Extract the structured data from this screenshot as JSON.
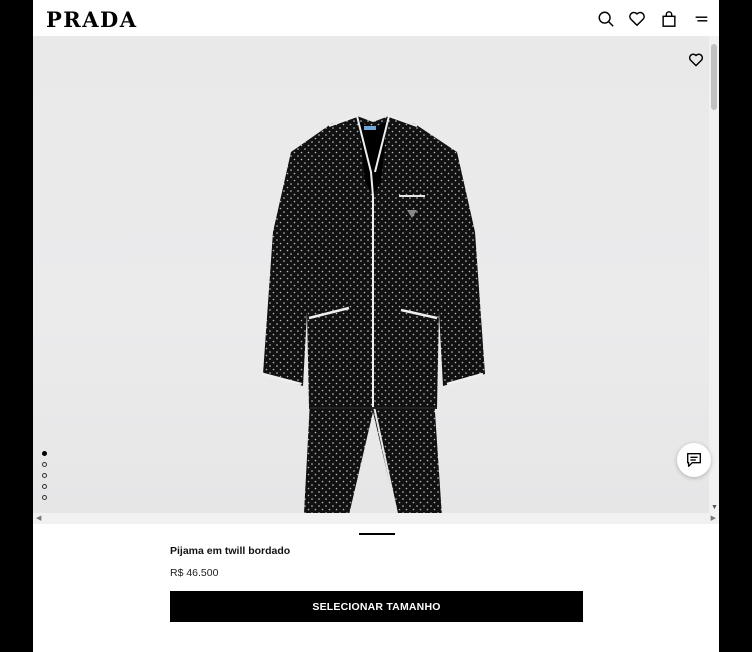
{
  "header": {
    "logo": "PRADA",
    "icons": [
      "search-icon",
      "heart-icon",
      "shopping-bag-icon",
      "menu-icon"
    ]
  },
  "gallery": {
    "slide_count": 5,
    "active_slide": 1,
    "favorite_icon": "heart-icon",
    "chat_icon": "chat-icon"
  },
  "product": {
    "name": "Pijama em twill bordado",
    "price": "R$ 46.500",
    "cta_label": "SELECIONAR TAMANHO"
  },
  "colors": {
    "page_bg": "#000000",
    "content_bg": "#ffffff",
    "gallery_bg": "#e9e9ea",
    "button_bg": "#000000",
    "button_text": "#ffffff"
  }
}
